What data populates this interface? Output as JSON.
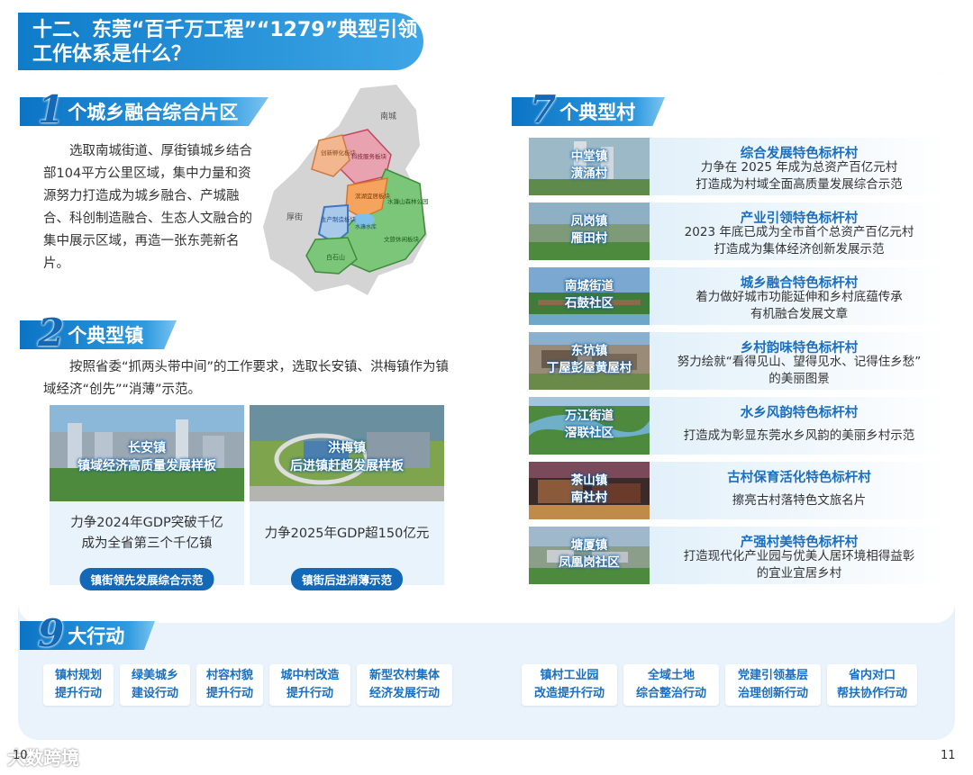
{
  "header": {
    "line1": "十二、东莞“百千万工程”“1279”典型引领",
    "line2": "工作体系是什么？"
  },
  "section1": {
    "num": "1",
    "label": "个城乡融合综合片区",
    "text": "选取南城街道、厚街镇城乡结合部104平方公里区域，集中力量和资源努力打造成为城乡融合、产城融合、科创制造融合、生态人文融合的集中展示区域，再造一张东莞新名片。",
    "map_labels": {
      "north": "南城",
      "west": "厚街",
      "zone_a": "创新孵化板块",
      "zone_b": "科技服务板块",
      "zone_c": "滨湖宜居板块",
      "zone_d": "水濂山森林公园",
      "zone_e": "生产制造板块",
      "zone_f": "水濂水库",
      "zone_g": "文旅休闲板块",
      "zone_h": "白石山"
    }
  },
  "section2": {
    "num": "2",
    "label": "个典型镇",
    "text": "按照省委“抓两头带中间”的工作要求，选取长安镇、洪梅镇作为镇域经济“创先”“消薄”示范。",
    "towns": [
      {
        "name": "长安镇",
        "subtitle": "镇域经济高质量发展样板",
        "desc1": "力争2024年GDP突破千亿",
        "desc2": "成为全省第三个千亿镇",
        "tag": "镇街领先发展综合示范"
      },
      {
        "name": "洪梅镇",
        "subtitle": "后进镇赶超发展样板",
        "desc1": "力争2025年GDP超150亿元",
        "desc2": "",
        "tag": "镇街后进消薄示范"
      }
    ]
  },
  "section7": {
    "num": "7",
    "label": "个典型村",
    "villages": [
      {
        "town": "中堂镇",
        "village": "潢涌村",
        "title": "综合发展特色标杆村",
        "desc1": "力争在 2025 年成为总资产百亿元村",
        "desc2": "打造成为村域全面高质量发展综合示范"
      },
      {
        "town": "凤岗镇",
        "village": "雁田村",
        "title": "产业引领特色标杆村",
        "desc1": "2023 年底已成为全市首个总资产百亿元村",
        "desc2": "打造成为集体经济创新发展示范"
      },
      {
        "town": "南城街道",
        "village": "石鼓社区",
        "title": "城乡融合特色标杆村",
        "desc1": "着力做好城市功能延伸和乡村底蕴传承",
        "desc2": "有机融合发展文章"
      },
      {
        "town": "东坑镇",
        "village": "丁屋彭屋黄屋村",
        "title": "乡村韵味特色标杆村",
        "desc1": "努力绘就“看得见山、望得见水、记得住乡愁”",
        "desc2": "的美丽图景"
      },
      {
        "town": "万江街道",
        "village": "滘联社区",
        "title": "水乡风韵特色标杆村",
        "desc1": "打造成为彰显东莞水乡风韵的美丽乡村示范",
        "desc2": ""
      },
      {
        "town": "茶山镇",
        "village": "南社村",
        "title": "古村保育活化特色标杆村",
        "desc1": "擦亮古村落特色文旅名片",
        "desc2": ""
      },
      {
        "town": "塘厦镇",
        "village": "凤凰岗社区",
        "title": "产强村美特色标杆村",
        "desc1": "打造现代化产业园与优美人居环境相得益彰",
        "desc2": "的宜业宜居乡村"
      }
    ]
  },
  "section9": {
    "num": "9",
    "label": "大行动",
    "actions": [
      {
        "l1": "镇村规划",
        "l2": "提升行动"
      },
      {
        "l1": "绿美城乡",
        "l2": "建设行动"
      },
      {
        "l1": "村容村貌",
        "l2": "提升行动"
      },
      {
        "l1": "城中村改造",
        "l2": "提升行动"
      },
      {
        "l1": "新型农村集体",
        "l2": "经济发展行动"
      },
      {
        "l1": "镇村工业园",
        "l2": "改造提升行动"
      },
      {
        "l1": "全域土地",
        "l2": "综合整治行动"
      },
      {
        "l1": "党建引领基层",
        "l2": "治理创新行动"
      },
      {
        "l1": "省内对口",
        "l2": "帮扶协作行动"
      }
    ]
  },
  "footer": {
    "page_left": "10",
    "page_right": "11",
    "watermark": "大数跨境"
  },
  "colors": {
    "primary": "#1368b7",
    "accent": "#2e9ae0",
    "panel": "#eaf3fb"
  }
}
